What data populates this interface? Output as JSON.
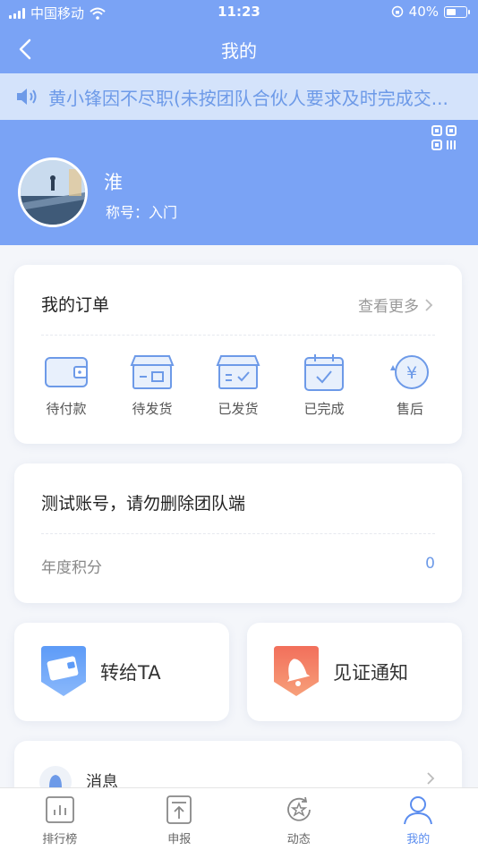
{
  "status_bar": {
    "carrier": "中国移动",
    "time": "11:23",
    "battery": "40%"
  },
  "nav": {
    "title": "我的"
  },
  "notice": {
    "text": "黄小锋因不尽职(未按团队合伙人要求及时完成交..."
  },
  "profile": {
    "name": "淮",
    "rank_label": "称号：入门"
  },
  "orders": {
    "title": "我的订单",
    "more": "查看更多",
    "items": [
      {
        "label": "待付款",
        "icon": "wallet-icon"
      },
      {
        "label": "待发货",
        "icon": "box-icon"
      },
      {
        "label": "已发货",
        "icon": "shipped-box-icon"
      },
      {
        "label": "已完成",
        "icon": "calendar-check-icon"
      },
      {
        "label": "售后",
        "icon": "yen-refund-icon"
      }
    ]
  },
  "account": {
    "title": "测试账号，请勿删除团队端",
    "points_label": "年度积分",
    "points_value": "0"
  },
  "features": [
    {
      "label": "转给TA",
      "icon": "wallet-transfer-icon"
    },
    {
      "label": "见证通知",
      "icon": "bell-icon"
    }
  ],
  "messages": {
    "label": "消息"
  },
  "tabbar": [
    {
      "label": "排行榜",
      "icon": "chart-icon"
    },
    {
      "label": "申报",
      "icon": "upload-icon"
    },
    {
      "label": "动态",
      "icon": "star-refresh-icon"
    },
    {
      "label": "我的",
      "icon": "person-icon",
      "active": true
    }
  ],
  "colors": {
    "primary": "#7aa3f5",
    "accent_blue": "#6d9ae8",
    "notice_bg": "#d4e3fb",
    "active_tab": "#5b8def"
  }
}
